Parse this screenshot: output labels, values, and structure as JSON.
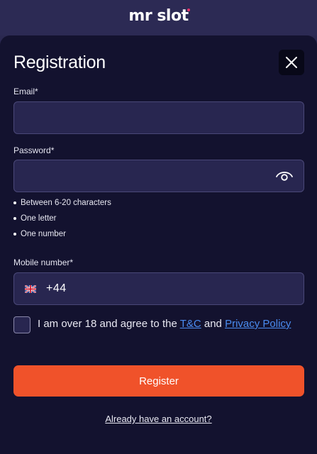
{
  "brand": {
    "logo_text": "mr slot",
    "accent": "#e8336b"
  },
  "modal": {
    "title": "Registration",
    "close_icon": "close-icon"
  },
  "email": {
    "label": "Email*",
    "value": "",
    "placeholder": ""
  },
  "password": {
    "label": "Password*",
    "value": "",
    "placeholder": "",
    "toggle_icon": "eye-icon",
    "rules": [
      "Between 6-20 characters",
      "One letter",
      "One number"
    ]
  },
  "mobile": {
    "label": "Mobile number*",
    "country_flag": "uk-flag-icon",
    "dial_code": "+44",
    "value": ""
  },
  "terms": {
    "checked": false,
    "prefix": "I am over 18 and agree to the ",
    "tc_link": "T&C",
    "middle": " and ",
    "privacy_link": "Privacy Policy"
  },
  "register_button": {
    "label": "Register",
    "color": "#f0522a"
  },
  "login_link": {
    "label": "Already have an account?"
  },
  "colors": {
    "background": "#2a2850",
    "modal": "#13122f",
    "field": "#282650",
    "link": "#4a8cf0"
  }
}
